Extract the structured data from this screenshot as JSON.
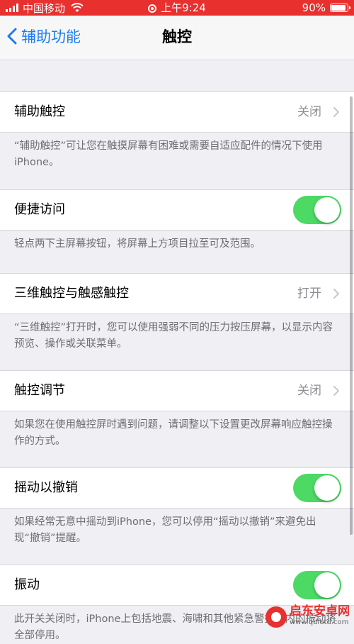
{
  "status_bar": {
    "carrier": "中国移动",
    "time": "上午9:24",
    "battery": "90%"
  },
  "nav": {
    "back_label": "辅助功能",
    "title": "触控"
  },
  "sections": [
    {
      "label": "辅助触控",
      "value": "关闭",
      "type": "disclosure",
      "footer": "“辅助触控”可让您在触摸屏幕有困难或需要自适应配件的情况下使用iPhone。"
    },
    {
      "label": "便捷访问",
      "type": "toggle",
      "on": true,
      "footer": "轻点两下主屏幕按钮，将屏幕上方项目拉至可及范围。"
    },
    {
      "label": "三维触控与触感触控",
      "value": "打开",
      "type": "disclosure",
      "footer": "“三维触控”打开时，您可以使用强弱不同的压力按压屏幕，以显示内容预览、操作或关联菜单。"
    },
    {
      "label": "触控调节",
      "value": "关闭",
      "type": "disclosure",
      "footer": "如果您在使用触控屏时遇到问题，请调整以下设置更改屏幕响应触控操作的方式。"
    },
    {
      "label": "摇动以撤销",
      "type": "toggle",
      "on": true,
      "footer": "如果经常无意中摇动到iPhone，您可以停用“摇动以撤销”来避免出现“撤销”提醒。"
    },
    {
      "label": "振动",
      "type": "toggle",
      "on": true,
      "footer": "此开关关闭时，iPhone上包括地震、海啸和其他紧急警报在内的振动将全部停用。"
    }
  ],
  "watermark": {
    "name": "启东安卓网",
    "url": "www.qdlutd.com"
  },
  "colors": {
    "status_bar_bg": "#e8302f",
    "accent": "#1a7cf5",
    "toggle_on": "#4cd964",
    "background": "#efeff4"
  }
}
